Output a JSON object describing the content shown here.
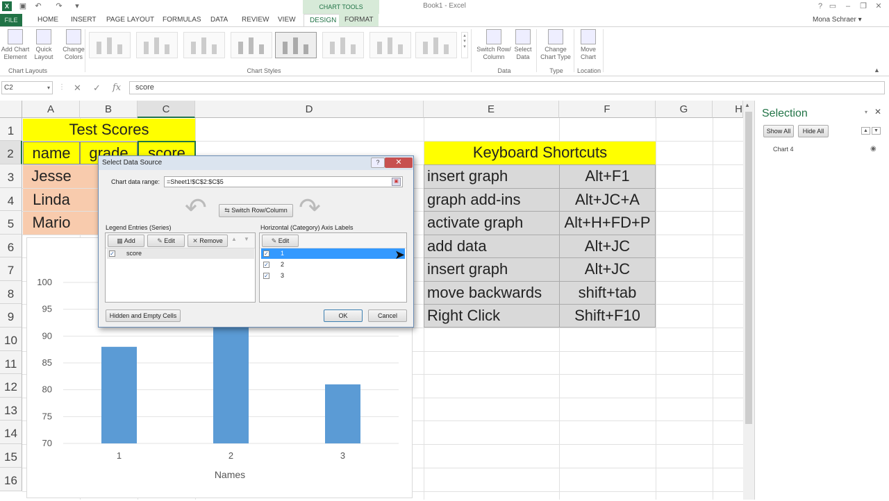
{
  "window": {
    "title": "Book1 - Excel",
    "user": "Mona Schraer",
    "chart_tools_label": "CHART TOOLS"
  },
  "tabs": [
    "FILE",
    "HOME",
    "INSERT",
    "PAGE LAYOUT",
    "FORMULAS",
    "DATA",
    "REVIEW",
    "VIEW",
    "DESIGN",
    "FORMAT"
  ],
  "ribbon": {
    "add_chart_element": "Add Chart Element",
    "quick_layout": "Quick Layout",
    "change_colors": "Change Colors",
    "group_chart_layouts": "Chart Layouts",
    "group_chart_styles": "Chart Styles",
    "switch_row_column": "Switch Row/ Column",
    "select_data": "Select Data",
    "group_data": "Data",
    "change_chart_type": "Change Chart Type",
    "group_type": "Type",
    "move_chart": "Move Chart",
    "group_location": "Location"
  },
  "formula_bar": {
    "name_box": "C2",
    "fx": "fx",
    "formula": "score"
  },
  "columns": [
    "A",
    "B",
    "C",
    "D",
    "E",
    "F",
    "G",
    "H"
  ],
  "rows": [
    "1",
    "2",
    "3",
    "4",
    "5",
    "6",
    "7",
    "8",
    "9",
    "10",
    "11",
    "12",
    "13",
    "14",
    "15",
    "16"
  ],
  "sheet": {
    "title": "Test Scores",
    "headers": [
      "name",
      "grade",
      "score"
    ],
    "names": [
      "Jesse",
      "Linda",
      "Mario"
    ],
    "shortcuts_title": "Keyboard Shortcuts",
    "shortcuts": [
      {
        "action": "insert graph",
        "keys": "Alt+F1"
      },
      {
        "action": "graph add-ins",
        "keys": "Alt+JC+A"
      },
      {
        "action": "activate graph",
        "keys": "Alt+H+FD+P"
      },
      {
        "action": "add data",
        "keys": "Alt+JC"
      },
      {
        "action": "insert graph",
        "keys": "Alt+JC"
      },
      {
        "action": "move backwards",
        "keys": "shift+tab"
      },
      {
        "action": "Right Click",
        "keys": "Shift+F10"
      }
    ]
  },
  "chart_data": {
    "type": "bar",
    "categories": [
      "1",
      "2",
      "3"
    ],
    "values": [
      88,
      92,
      81
    ],
    "ylim": [
      70,
      100
    ],
    "yticks": [
      "70",
      "75",
      "80",
      "85",
      "90",
      "95",
      "100"
    ],
    "xlabel": "Names",
    "grid": true,
    "color": "#5b9bd5"
  },
  "dialog": {
    "title": "Select Data Source",
    "help": "?",
    "close": "✕",
    "range_label": "Chart data range:",
    "range_value": "=Sheet1!$C$2:$C$5",
    "switch_button": "Switch Row/Column",
    "legend_label": "Legend Entries (Series)",
    "add": "Add",
    "edit": "Edit",
    "remove": "Remove",
    "series": [
      "score"
    ],
    "axis_label": "Horizontal (Category) Axis Labels",
    "axis_edit": "Edit",
    "axis_items": [
      "1",
      "2",
      "3"
    ],
    "hidden_cells": "Hidden and Empty Cells",
    "ok": "OK",
    "cancel": "Cancel"
  },
  "selection_pane": {
    "title": "Selection",
    "show_all": "Show All",
    "hide_all": "Hide All",
    "items": [
      "Chart 4"
    ]
  }
}
